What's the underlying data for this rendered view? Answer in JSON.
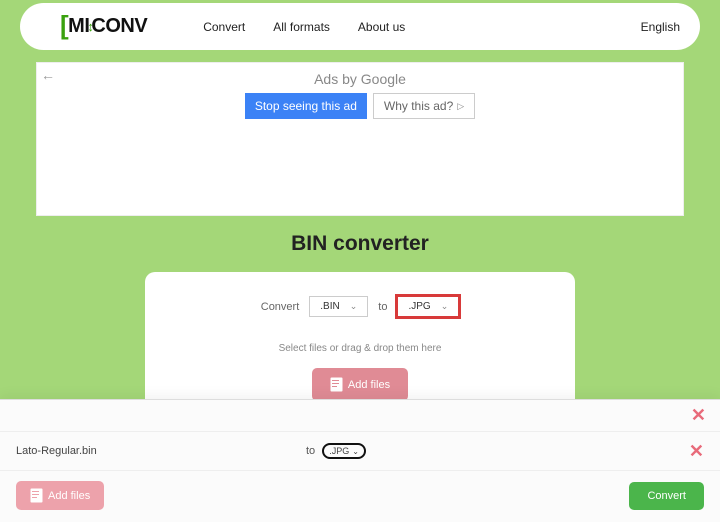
{
  "logo": {
    "part1": "MI",
    "part2": "CONV"
  },
  "nav": {
    "convert": "Convert",
    "all_formats": "All formats",
    "about": "About us"
  },
  "lang": "English",
  "ads": {
    "header": "Ads by Google",
    "stop": "Stop seeing this ad",
    "why": "Why this ad?"
  },
  "title": "BIN converter",
  "card": {
    "convert_label": "Convert",
    "from_fmt": ".BIN",
    "to_label": "to",
    "to_fmt": ".JPG",
    "hint": "Select files or drag & drop them here",
    "add_files": "Add files"
  },
  "panel": {
    "file_name": "Lato-Regular.bin",
    "to_label": "to",
    "to_fmt": ".JPG",
    "add_files": "Add files",
    "convert": "Convert"
  }
}
